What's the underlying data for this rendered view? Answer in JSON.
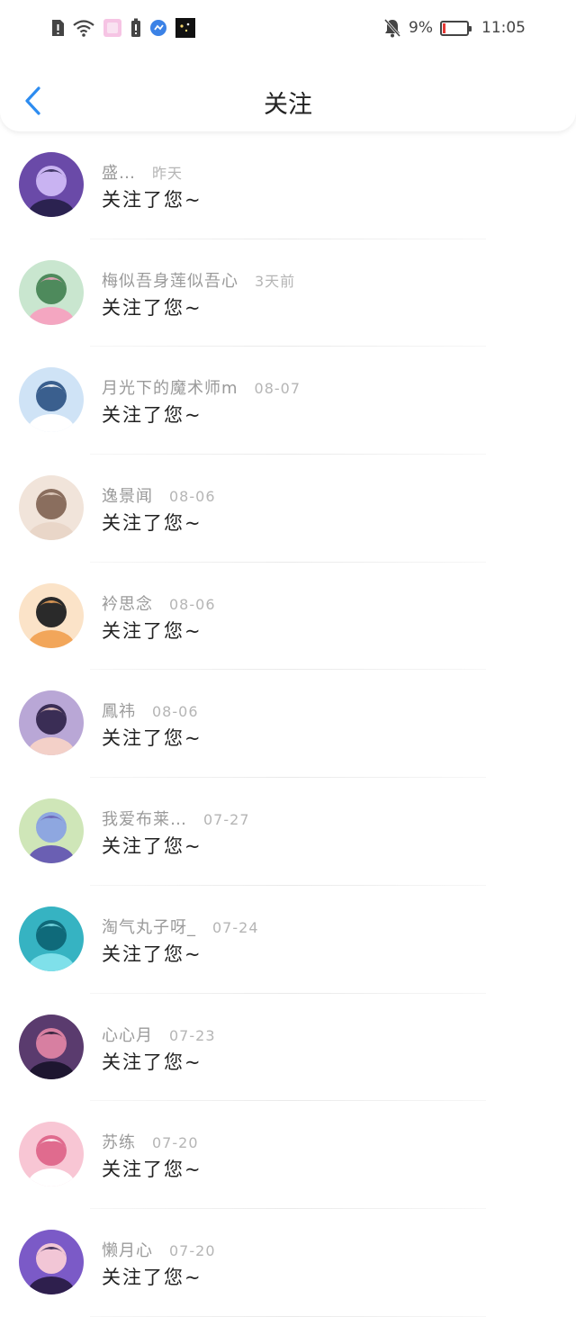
{
  "status_bar": {
    "battery": "9%",
    "time": "11:05",
    "battery_level": 0.09,
    "left_icons": [
      "alert-icon",
      "wifi-icon",
      "app-notification-icon",
      "battery-alert-icon",
      "browser-icon",
      "app-notification-icon"
    ],
    "right_icons": [
      "bell-off-icon",
      "battery-icon"
    ]
  },
  "header": {
    "title": "关注",
    "back_icon": "chevron-left-icon",
    "accent_color": "#2d8cf0"
  },
  "follows": [
    {
      "name": "盛…",
      "time": "昨天",
      "message": "关注了您~"
    },
    {
      "name": "梅似吾身莲似吾心",
      "time": "3天前",
      "message": "关注了您~"
    },
    {
      "name": "月光下的魔术师m",
      "time": "08-07",
      "message": "关注了您~"
    },
    {
      "name": "逸景闻",
      "time": "08-06",
      "message": "关注了您~"
    },
    {
      "name": "衿思念",
      "time": "08-06",
      "message": "关注了您~"
    },
    {
      "name": "鳳祎",
      "time": "08-06",
      "message": "关注了您~"
    },
    {
      "name": "我爱布莱…",
      "time": "07-27",
      "message": "关注了您~"
    },
    {
      "name": "淘气丸子呀_",
      "time": "07-24",
      "message": "关注了您~"
    },
    {
      "name": "心心月",
      "time": "07-23",
      "message": "关注了您~"
    },
    {
      "name": "苏练",
      "time": "07-20",
      "message": "关注了您~"
    },
    {
      "name": "懒月心",
      "time": "07-20",
      "message": "关注了您~"
    }
  ]
}
